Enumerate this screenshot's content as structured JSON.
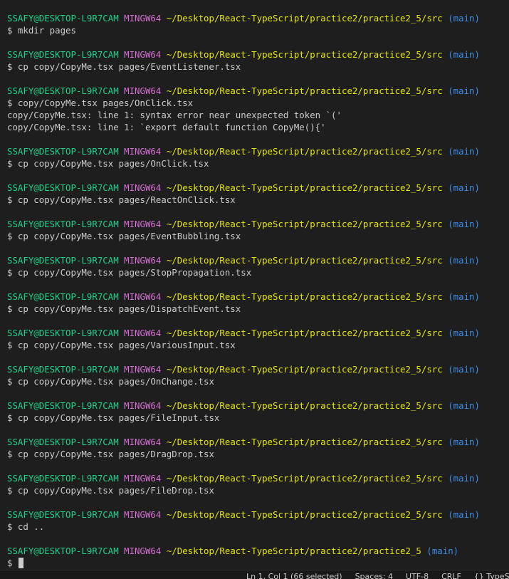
{
  "prompt": {
    "user": "SSAFY@DESKTOP-L9R7CAM",
    "msystem": "MINGW64",
    "branch": "(main)"
  },
  "entries": [
    {
      "path": "~/Desktop/React-TypeScript/practice2/practice2_5/src",
      "command": "$ mkdir pages",
      "output": []
    },
    {
      "path": "~/Desktop/React-TypeScript/practice2/practice2_5/src",
      "command": "$ cp copy/CopyMe.tsx pages/EventListener.tsx",
      "output": []
    },
    {
      "path": "~/Desktop/React-TypeScript/practice2/practice2_5/src",
      "command": "$ copy/CopyMe.tsx pages/OnClick.tsx",
      "output": [
        "copy/CopyMe.tsx: line 1: syntax error near unexpected token `('",
        "copy/CopyMe.tsx: line 1: `export default function CopyMe(){'"
      ]
    },
    {
      "path": "~/Desktop/React-TypeScript/practice2/practice2_5/src",
      "command": "$ cp copy/CopyMe.tsx pages/OnClick.tsx",
      "output": []
    },
    {
      "path": "~/Desktop/React-TypeScript/practice2/practice2_5/src",
      "command": "$ cp copy/CopyMe.tsx pages/ReactOnClick.tsx",
      "output": []
    },
    {
      "path": "~/Desktop/React-TypeScript/practice2/practice2_5/src",
      "command": "$ cp copy/CopyMe.tsx pages/EventBubbling.tsx",
      "output": []
    },
    {
      "path": "~/Desktop/React-TypeScript/practice2/practice2_5/src",
      "command": "$ cp copy/CopyMe.tsx pages/StopPropagation.tsx",
      "output": []
    },
    {
      "path": "~/Desktop/React-TypeScript/practice2/practice2_5/src",
      "command": "$ cp copy/CopyMe.tsx pages/DispatchEvent.tsx",
      "output": []
    },
    {
      "path": "~/Desktop/React-TypeScript/practice2/practice2_5/src",
      "command": "$ cp copy/CopyMe.tsx pages/VariousInput.tsx",
      "output": []
    },
    {
      "path": "~/Desktop/React-TypeScript/practice2/practice2_5/src",
      "command": "$ cp copy/CopyMe.tsx pages/OnChange.tsx",
      "output": []
    },
    {
      "path": "~/Desktop/React-TypeScript/practice2/practice2_5/src",
      "command": "$ cp copy/CopyMe.tsx pages/FileInput.tsx",
      "output": []
    },
    {
      "path": "~/Desktop/React-TypeScript/practice2/practice2_5/src",
      "command": "$ cp copy/CopyMe.tsx pages/DragDrop.tsx",
      "output": []
    },
    {
      "path": "~/Desktop/React-TypeScript/practice2/practice2_5/src",
      "command": "$ cp copy/CopyMe.tsx pages/FileDrop.tsx",
      "output": []
    },
    {
      "path": "~/Desktop/React-TypeScript/practice2/practice2_5/src",
      "command": "$ cd ..",
      "output": []
    },
    {
      "path": "~/Desktop/React-TypeScript/practice2/practice2_5",
      "command": "$",
      "output": [],
      "active": true
    }
  ],
  "statusbar": {
    "items": [
      "Ln 1, Col 1 (66 selected)",
      "Spaces: 4",
      "UTF-8",
      "CRLF",
      "{} TypeScript"
    ]
  }
}
